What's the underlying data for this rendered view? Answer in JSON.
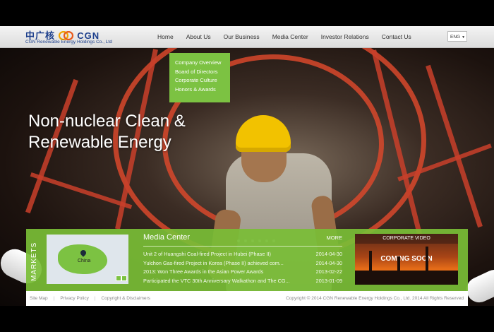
{
  "brand": {
    "logo_cn": "中广核",
    "logo_en": "CGN",
    "company_name": "CGN Renewable Energy Holdings Co., Ltd"
  },
  "nav": {
    "items": [
      {
        "label": "Home"
      },
      {
        "label": "About Us"
      },
      {
        "label": "Our Business"
      },
      {
        "label": "Media Center"
      },
      {
        "label": "Investor Relations"
      },
      {
        "label": "Contact Us"
      }
    ],
    "language": "ENG"
  },
  "about_menu": {
    "items": [
      {
        "label": "Company Overview"
      },
      {
        "label": "Board of Directors"
      },
      {
        "label": "Corporate Culture"
      },
      {
        "label": "Honors & Awards"
      }
    ]
  },
  "hero": {
    "title_line1": "Non-nuclear Clean &",
    "title_line2": "Renewable Energy",
    "slide_count": 6
  },
  "markets": {
    "label": "MARKETS",
    "map_label": "China"
  },
  "media_center": {
    "title": "Media Center",
    "more": "MORE",
    "news": [
      {
        "title": "Unit 2 of Huangshi Coal-fired Project in Hubei (Phase II)",
        "date": "2014-04-30"
      },
      {
        "title": "Yulchon Gas-fired Project in Korea (Phase II) achieved com...",
        "date": "2014-04-30"
      },
      {
        "title": "2013: Won Three Awards in the Asian Power Awards",
        "date": "2013-02-22"
      },
      {
        "title": "Participated the VTC 30th Anniversary Walkathon and The CG...",
        "date": "2013-01-09"
      }
    ]
  },
  "corporate_video": {
    "header": "CORPORATE VIDEO",
    "status": "COMING SOON"
  },
  "footer": {
    "links": [
      {
        "label": "Site Map"
      },
      {
        "label": "Privacy Policy"
      },
      {
        "label": "Copyright & Disclaimers"
      }
    ],
    "copyright": "Copyright © 2014 CGN Renewable Energy Holdings Co., Ltd. 2014 All Rights Reserved"
  },
  "colors": {
    "accent_green": "#7cc242",
    "brand_blue": "#1d3f8c"
  }
}
